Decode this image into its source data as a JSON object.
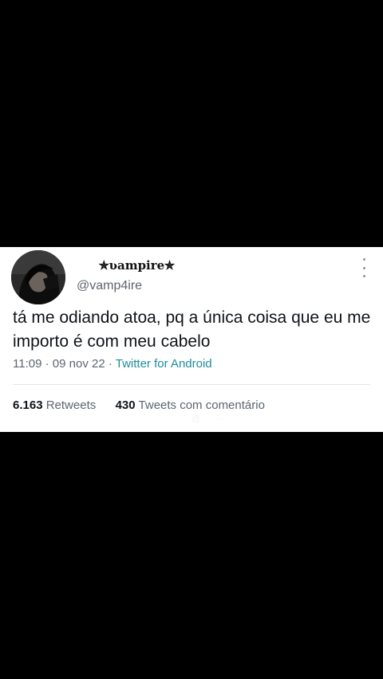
{
  "tweet": {
    "display_name": "✯ʋampire✯",
    "handle": "@vamp4ire",
    "text": "tá me odiando atoa, pq a única coisa que eu me importo é com meu cabelo",
    "time": "11:09",
    "date": "09 nov 22",
    "separator": "·",
    "source": "Twitter for Android",
    "retweets_count": "6.163",
    "retweets_label": "Retweets",
    "quotes_count": "430",
    "quotes_label": "Tweets com comentário",
    "ghost_text": "@ · ·········"
  },
  "icons": {
    "more": "more-vertical-icon",
    "avatar": "profile-avatar"
  },
  "colors": {
    "background": "#000000",
    "card": "#ffffff",
    "text": "#0f1419",
    "muted": "#5b6670",
    "source_link": "#1d8d9b"
  }
}
